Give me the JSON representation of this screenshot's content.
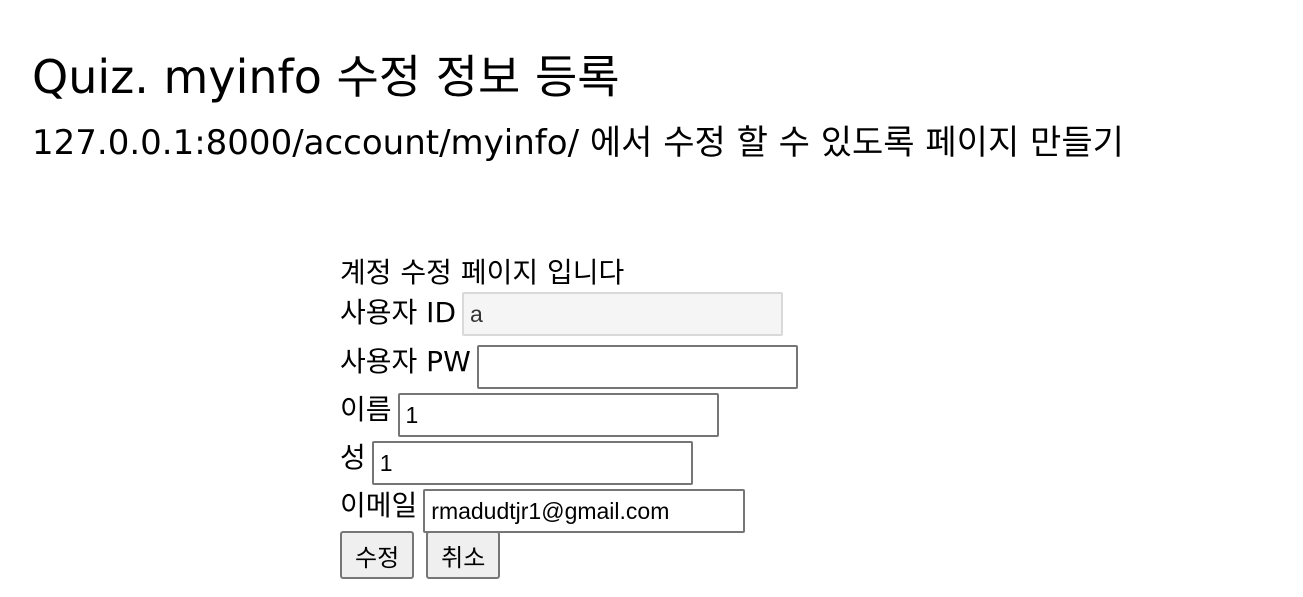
{
  "page": {
    "title": "Quiz. myinfo 수정 정보 등록",
    "description": "127.0.0.1:8000/account/myinfo/ 에서 수정 할 수 있도록 페이지 만들기"
  },
  "form": {
    "heading": "계정 수정 페이지 입니다",
    "user_id": {
      "label": "사용자 ID",
      "value": "a"
    },
    "user_pw": {
      "label": "사용자 PW",
      "value": ""
    },
    "first_name": {
      "label": "이름",
      "value": "1"
    },
    "last_name": {
      "label": "성",
      "value": "1"
    },
    "email": {
      "label": "이메일",
      "value": "rmadudtjr1@gmail.com"
    },
    "submit_label": "수정",
    "cancel_label": "취소"
  }
}
